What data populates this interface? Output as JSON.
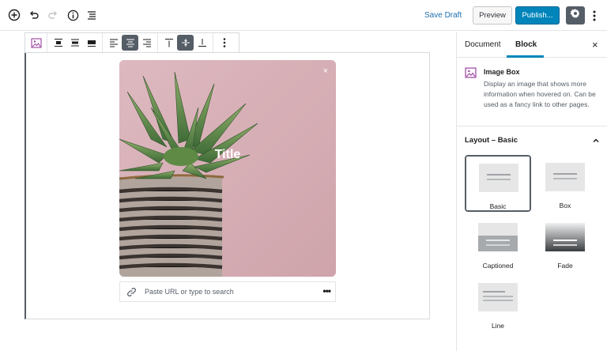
{
  "topbar": {
    "save_draft": "Save Draft",
    "preview": "Preview",
    "publish": "Publish..."
  },
  "image_box": {
    "title": "Title",
    "close": "×"
  },
  "url_bar": {
    "placeholder": "Paste URL or type to search",
    "more": "•••"
  },
  "sidebar": {
    "tabs": [
      {
        "label": "Document"
      },
      {
        "label": "Block"
      }
    ],
    "close": "×",
    "block": {
      "name": "Image Box",
      "description": "Display an image that shows more information when hovered on. Can be used as a fancy link to other pages."
    },
    "layout_panel": {
      "title": "Layout – Basic",
      "options": [
        {
          "label": "Basic"
        },
        {
          "label": "Box"
        },
        {
          "label": "Captioned"
        },
        {
          "label": "Fade"
        },
        {
          "label": "Line"
        }
      ]
    }
  },
  "colors": {
    "accent": "#0085ba",
    "save_draft": "#1e6fae",
    "image_bg": "#d7b2b8"
  },
  "icons": [
    "add-block-icon",
    "undo-icon",
    "redo-icon",
    "info-icon",
    "outline-icon",
    "gear-icon",
    "more-vertical-icon",
    "image-icon",
    "link-icon",
    "chevron-up-icon",
    "close-icon"
  ]
}
